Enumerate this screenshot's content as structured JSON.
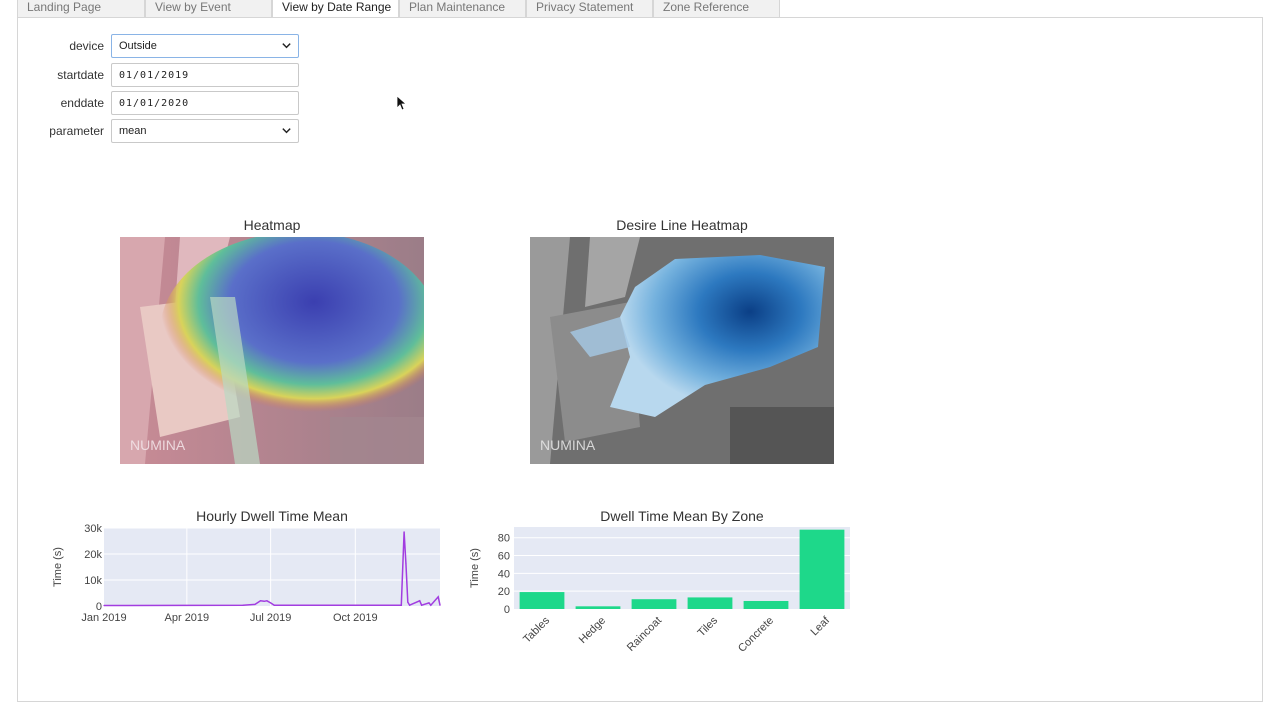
{
  "tabs": [
    {
      "label": "Landing Page",
      "active": false
    },
    {
      "label": "View by Event",
      "active": false
    },
    {
      "label": "View by Date Range",
      "active": true
    },
    {
      "label": "Plan Maintenance",
      "active": false
    },
    {
      "label": "Privacy Statement",
      "active": false
    },
    {
      "label": "Zone Reference",
      "active": false
    }
  ],
  "form": {
    "device": {
      "label": "device",
      "value": "Outside"
    },
    "startdate": {
      "label": "startdate",
      "value": "01/01/2019"
    },
    "enddate": {
      "label": "enddate",
      "value": "01/01/2020"
    },
    "parameter": {
      "label": "parameter",
      "value": "mean"
    }
  },
  "heatmap": {
    "title": "Heatmap",
    "watermark": "NUMINA"
  },
  "desire_heatmap": {
    "title": "Desire Line Heatmap",
    "watermark": "NUMINA"
  },
  "colors": {
    "line": "#a23de0",
    "bar": "#1ed88a",
    "plot_bg": "#e5e9f4",
    "grid": "#ffffff"
  },
  "chart_data": [
    {
      "type": "line",
      "title": "Hourly Dwell Time Mean",
      "ylabel": "Time (s)",
      "xlabel": "",
      "x_ticks": [
        "Jan 2019",
        "Apr 2019",
        "Jul 2019",
        "Oct 2019"
      ],
      "y_ticks": [
        "0",
        "10k",
        "20k",
        "30k"
      ],
      "ylim": [
        0,
        30000
      ],
      "x_range": [
        "2019-01-01",
        "2020-01-01"
      ],
      "series": [
        {
          "points": [
            [
              "2019-01-01",
              200
            ],
            [
              "2019-06-01",
              300
            ],
            [
              "2019-06-14",
              600
            ],
            [
              "2019-06-20",
              2000
            ],
            [
              "2019-06-24",
              1800
            ],
            [
              "2019-06-27",
              2000
            ],
            [
              "2019-07-01",
              1200
            ],
            [
              "2019-07-05",
              300
            ],
            [
              "2019-11-20",
              300
            ],
            [
              "2019-11-23",
              28500
            ],
            [
              "2019-11-25",
              16500
            ],
            [
              "2019-11-27",
              1500
            ],
            [
              "2019-11-29",
              300
            ],
            [
              "2019-12-10",
              2000
            ],
            [
              "2019-12-12",
              300
            ],
            [
              "2019-12-20",
              1200
            ],
            [
              "2019-12-22",
              300
            ],
            [
              "2019-12-30",
              3500
            ],
            [
              "2020-01-01",
              300
            ]
          ]
        }
      ]
    },
    {
      "type": "bar",
      "title": "Dwell Time Mean By Zone",
      "ylabel": "Time (s)",
      "xlabel": "",
      "categories": [
        "Tables",
        "Hedge",
        "Raincoat",
        "Tiles",
        "Concrete",
        "Leaf"
      ],
      "values": [
        19,
        3,
        11,
        13,
        9,
        89
      ],
      "y_ticks": [
        "0",
        "20",
        "40",
        "60",
        "80"
      ],
      "ylim": [
        0,
        92
      ]
    }
  ]
}
